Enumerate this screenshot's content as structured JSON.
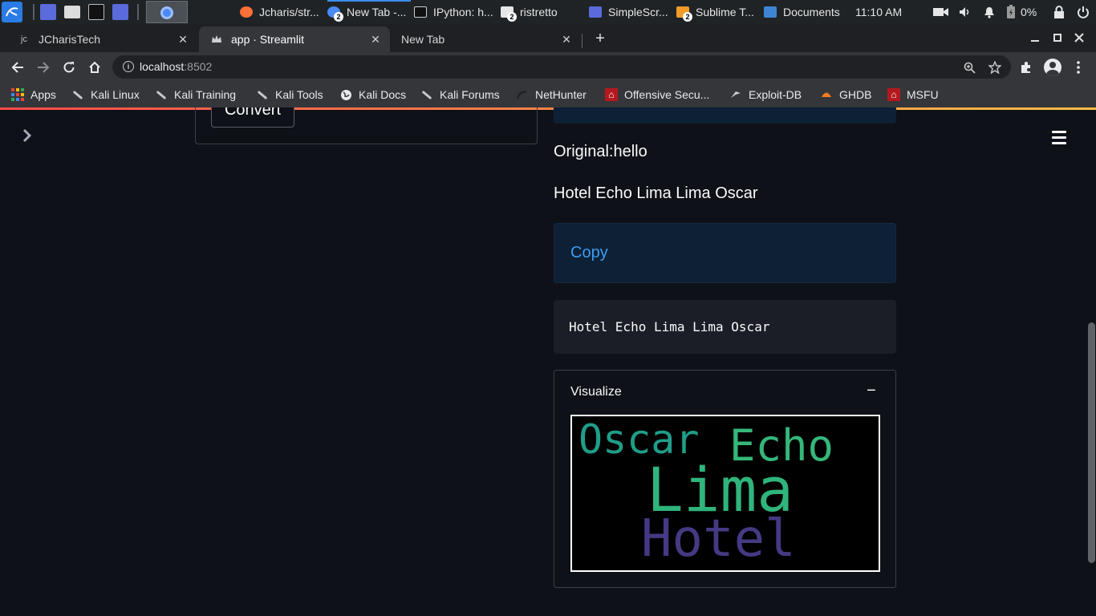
{
  "taskbar": {
    "windows": [
      {
        "label": "Jcharis/str...",
        "icon": "firefox-icon"
      },
      {
        "label": "New Tab -...",
        "icon": "chrome-icon",
        "count": "2"
      },
      {
        "label": "IPython: h...",
        "icon": "terminal-icon"
      },
      {
        "label": "ristretto",
        "icon": "image-viewer-icon",
        "count": "2"
      },
      {
        "label": "SimpleScr...",
        "icon": "screen-recorder-icon"
      },
      {
        "label": "Sublime T...",
        "icon": "sublime-icon",
        "count": "2"
      },
      {
        "label": "Documents",
        "icon": "folder-icon"
      }
    ],
    "clock": "11:10 AM",
    "battery": "0%"
  },
  "browser": {
    "tabs": [
      {
        "label": "JCharisTech",
        "favicon": "jc"
      },
      {
        "label": "app · Streamlit",
        "favicon": "crown-icon"
      },
      {
        "label": "New Tab",
        "favicon": ""
      }
    ],
    "url_host": "localhost",
    "url_port": ":8502",
    "bookmarks": [
      {
        "label": "Apps",
        "icon": "apps-grid-icon"
      },
      {
        "label": "Kali Linux",
        "icon": "kali-dragon-icon"
      },
      {
        "label": "Kali Training",
        "icon": "kali-dragon-icon"
      },
      {
        "label": "Kali Tools",
        "icon": "kali-dragon-icon"
      },
      {
        "label": "Kali Docs",
        "icon": "globe-icon"
      },
      {
        "label": "Kali Forums",
        "icon": "kali-dragon-icon"
      },
      {
        "label": "NetHunter",
        "icon": "nethunter-icon"
      },
      {
        "label": "Offensive Secu...",
        "icon": "offsec-icon"
      },
      {
        "label": "Exploit-DB",
        "icon": "exploit-db-icon"
      },
      {
        "label": "GHDB",
        "icon": "ghdb-icon"
      },
      {
        "label": "MSFU",
        "icon": "offsec-icon"
      }
    ]
  },
  "app": {
    "convert_label": "Convert",
    "original_text": "Original:hello",
    "nato_text": "Hotel Echo Lima Lima Oscar",
    "copy_label": "Copy",
    "code_text": "Hotel Echo Lima Lima Oscar",
    "expander_label": "Visualize",
    "expander_toggle": "−",
    "wordcloud": {
      "words": [
        {
          "text": "Oscar",
          "color": "#1f9e89"
        },
        {
          "text": "Echo",
          "color": "#35b779"
        },
        {
          "text": "Lima",
          "color": "#2fb47c"
        },
        {
          "text": "Hotel",
          "color": "#443a83"
        }
      ]
    }
  },
  "colors": {
    "streamlit_bg": "#0e1117",
    "info_bg": "#0e2036",
    "link": "#3d9df3",
    "accent_gradient_start": "#ff4b4b",
    "accent_gradient_end": "#ffbd45"
  }
}
